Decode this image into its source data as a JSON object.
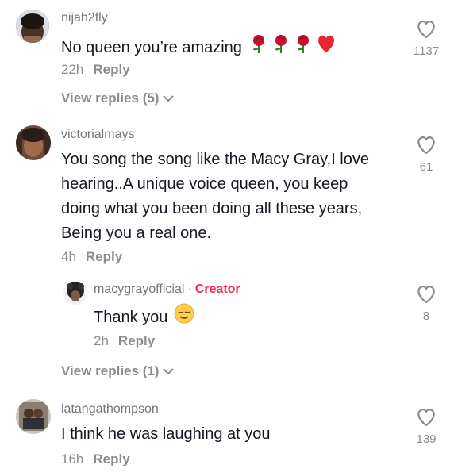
{
  "comments": [
    {
      "username": "nijah2fly",
      "text": "No queen you’re amazing",
      "time": "22h",
      "reply_label": "Reply",
      "likes": "1137",
      "view_replies": "View replies (5)"
    },
    {
      "username": "victorialmays",
      "lines": [
        "You song the song like the Macy Gray,I love",
        "hearing..A unique voice queen, you keep",
        "doing what you been doing all these years,",
        "Being you a real one."
      ],
      "time": "4h",
      "reply_label": "Reply",
      "likes": "61",
      "reply": {
        "username": "macygrayofficial",
        "separator": "·",
        "badge": "Creator",
        "text": "Thank you",
        "time": "2h",
        "reply_label": "Reply",
        "likes": "8"
      },
      "view_replies": "View replies (1)"
    },
    {
      "username": "latangathompson",
      "text": "I think he was laughing at you",
      "time": "16h",
      "reply_label": "Reply",
      "likes": "139"
    }
  ],
  "colors": {
    "text": "#161823",
    "muted": "#8a8b91",
    "creator": "#fe2c55",
    "rose": "#c8102e",
    "heart": "#e8262f"
  },
  "icons": [
    "heart-outline-icon",
    "chevron-down-icon",
    "rose-emoji",
    "red-heart-emoji",
    "relieved-face-emoji"
  ]
}
